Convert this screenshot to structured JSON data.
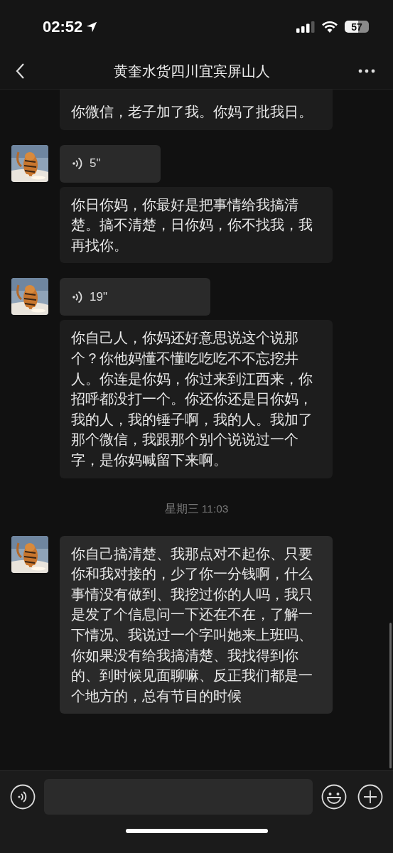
{
  "status_bar": {
    "time": "02:52",
    "battery": "57"
  },
  "header": {
    "title": "黄奎水货四川宜宾屏山人"
  },
  "messages": [
    {
      "kind": "text",
      "avatar": false,
      "text": "你微信，老子加了我。你妈了批我日。"
    },
    {
      "kind": "voice",
      "avatar": true,
      "duration": "5\""
    },
    {
      "kind": "text",
      "avatar": false,
      "text": "你日你妈，你最好是把事情给我搞清楚。搞不清楚，日你妈，你不找我，我再找你。"
    },
    {
      "kind": "voice",
      "avatar": true,
      "duration": "19\""
    },
    {
      "kind": "text",
      "avatar": false,
      "text": "你自己人，你妈还好意思说这个说那个？你他妈懂不懂吃吃吃不不忘挖井人。你连是你妈，你过来到江西来，你招呼都没打一个。你还你还是日你妈，我的人，我的锤子啊，我的人。我加了那个微信，我跟那个别个说说过一个字，是你妈喊留下来啊。"
    },
    {
      "kind": "time",
      "text": "星期三 11:03"
    },
    {
      "kind": "text",
      "avatar": true,
      "text": "你自己搞清楚、我那点对不起你、只要你和我对接的，少了你一分钱啊，什么事情没有做到、我挖过你的人吗，我只是发了个信息问一下还在不在，了解一下情况、我说过一个字叫她来上班吗、你如果没有给我搞清楚、我找得到你的、到时候见面聊嘛、反正我们都是一个地方的，总有节目的时候"
    }
  ]
}
